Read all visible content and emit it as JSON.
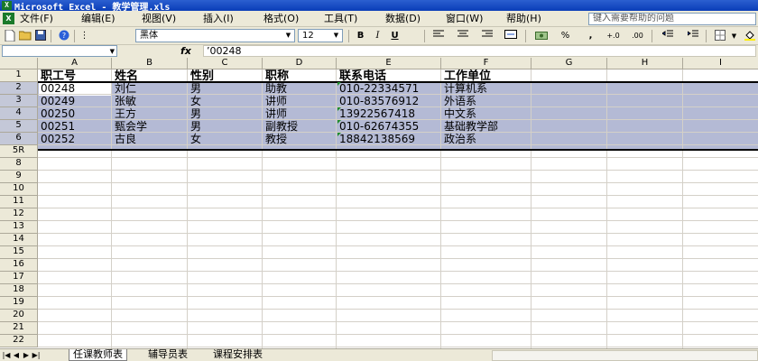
{
  "window": {
    "title": "Microsoft Excel - 教学管理.xls"
  },
  "menu": {
    "items": [
      "文件(F)",
      "编辑(E)",
      "视图(V)",
      "插入(I)",
      "格式(O)",
      "工具(T)",
      "数据(D)",
      "窗口(W)",
      "帮助(H)"
    ],
    "help_placeholder": "键入需要帮助的问题"
  },
  "toolbar": {
    "font_name": "黑体",
    "font_size": "12",
    "bold": "B",
    "italic": "I",
    "underline": "U",
    "percent": "%",
    "comma": ","
  },
  "formula_bar": {
    "fx": "fx",
    "value": "’00248"
  },
  "grid": {
    "columns": [
      "A",
      "B",
      "C",
      "D",
      "E",
      "F",
      "G",
      "H",
      "I"
    ],
    "rows": [
      "1",
      "2",
      "3",
      "4",
      "5",
      "6",
      "5R",
      "8",
      "9",
      "10",
      "11",
      "12",
      "13",
      "14",
      "15",
      "16",
      "17",
      "18",
      "19",
      "20",
      "21",
      "22"
    ],
    "header": [
      "职工号",
      "姓名",
      "性别",
      "职称",
      "联系电话",
      "工作单位"
    ],
    "data": [
      [
        "00248",
        "刘仁",
        "男",
        "助教",
        "010-22334571",
        "计算机系"
      ],
      [
        "00249",
        "张敏",
        "女",
        "讲师",
        "010-83576912",
        "外语系"
      ],
      [
        "00250",
        "王方",
        "男",
        "讲师",
        "13922567418",
        "中文系"
      ],
      [
        "00251",
        "甄会学",
        "男",
        "副教授",
        "010-62674355",
        "基础教学部"
      ],
      [
        "00252",
        "古良",
        "女",
        "教授",
        "18842138569",
        "政治系"
      ]
    ]
  },
  "sheets": {
    "tabs": [
      "任课教师表",
      "辅导员表",
      "课程安排表"
    ],
    "active": "任课教师表"
  }
}
